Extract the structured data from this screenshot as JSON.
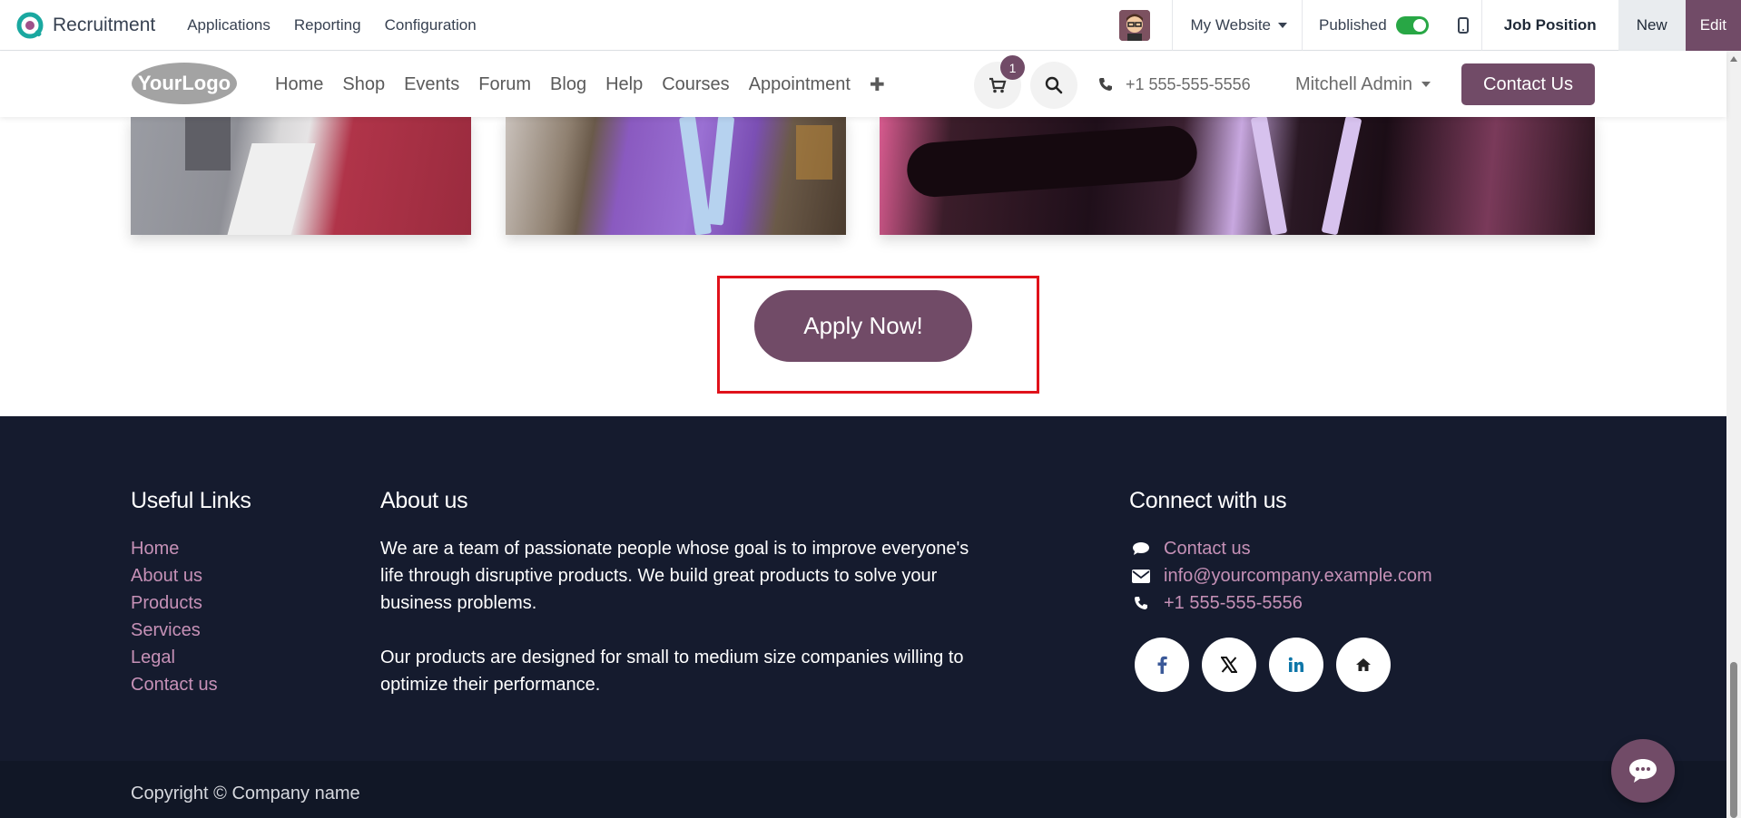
{
  "admin_bar": {
    "app_title": "Recruitment",
    "menu": [
      "Applications",
      "Reporting",
      "Configuration"
    ],
    "website_selector": "My Website",
    "published_label": "Published",
    "published_on": true,
    "job_position_label": "Job Position",
    "new_label": "New",
    "edit_label": "Edit"
  },
  "site_header": {
    "logo_text": "YourLogo",
    "nav": [
      "Home",
      "Shop",
      "Events",
      "Forum",
      "Blog",
      "Help",
      "Courses",
      "Appointment"
    ],
    "cart_count": "1",
    "phone": "+1 555-555-5556",
    "user": "Mitchell Admin",
    "contact_button": "Contact Us"
  },
  "apply": {
    "button_label": "Apply Now!"
  },
  "footer": {
    "useful_links": {
      "heading": "Useful Links",
      "items": [
        "Home",
        "About us",
        "Products",
        "Services",
        "Legal",
        "Contact us"
      ]
    },
    "about": {
      "heading": "About us",
      "paragraph_1": "We are a team of passionate people whose goal is to improve everyone's life through disruptive products. We build great products to solve your business problems.",
      "paragraph_2": "Our products are designed for small to medium size companies willing to optimize their performance."
    },
    "connect": {
      "heading": "Connect with us",
      "contact": "Contact us",
      "email": "info@yourcompany.example.com",
      "phone": "+1 555-555-5556",
      "social_icons": [
        "facebook-icon",
        "x-twitter-icon",
        "linkedin-icon",
        "home-icon"
      ]
    },
    "copyright": "Copyright © Company name"
  },
  "colors": {
    "brand": "#714b67",
    "footer_bg": "#151b2e",
    "link": "#c691b7",
    "highlight": "#e0121b",
    "toggle_on": "#28a745"
  }
}
